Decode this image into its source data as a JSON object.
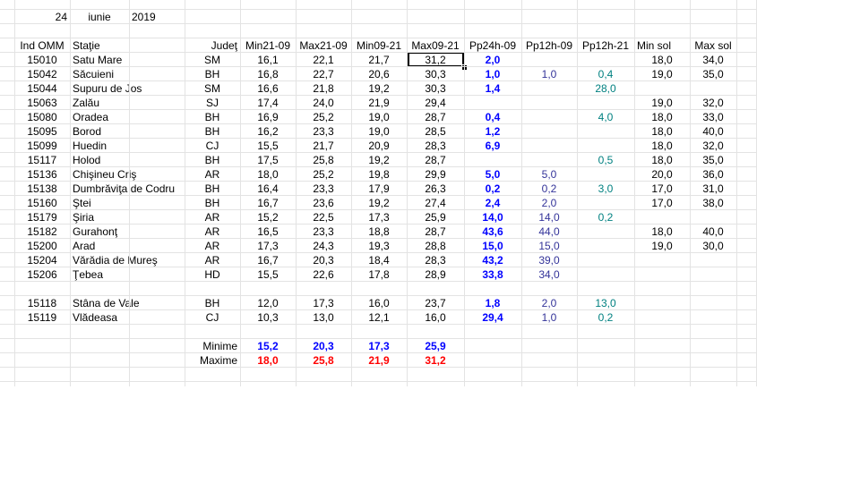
{
  "date": {
    "day": "24",
    "month": "iunie",
    "year": "2019"
  },
  "headers": [
    "Ind OMM",
    "Staţie",
    "Judeţ",
    "Min21-09",
    "Max21-09",
    "Min09-21",
    "Max09-21",
    "Pp24h-09",
    "Pp12h-09",
    "Pp12h-21",
    "Min sol",
    "Max sol"
  ],
  "rows": [
    {
      "ind": "15010",
      "statie": "Satu Mare",
      "judet": "SM",
      "min2109": "16,1",
      "max2109": "22,1",
      "min0921": "21,7",
      "max0921": "31,2",
      "pp24": "2,0",
      "pp12a": "",
      "pp12b": "",
      "minsol": "18,0",
      "maxsol": "34,0"
    },
    {
      "ind": "15042",
      "statie": "Săcuieni",
      "judet": "BH",
      "min2109": "16,8",
      "max2109": "22,7",
      "min0921": "20,6",
      "max0921": "30,3",
      "pp24": "1,0",
      "pp12a": "1,0",
      "pp12b": "0,4",
      "minsol": "19,0",
      "maxsol": "35,0"
    },
    {
      "ind": "15044",
      "statie": "Supuru de Jos",
      "judet": "SM",
      "min2109": "16,6",
      "max2109": "21,8",
      "min0921": "19,2",
      "max0921": "30,3",
      "pp24": "1,4",
      "pp12a": "",
      "pp12b": "28,0",
      "minsol": "",
      "maxsol": ""
    },
    {
      "ind": "15063",
      "statie": "Zalău",
      "judet": "SJ",
      "min2109": "17,4",
      "max2109": "24,0",
      "min0921": "21,9",
      "max0921": "29,4",
      "pp24": "",
      "pp12a": "",
      "pp12b": "",
      "minsol": "19,0",
      "maxsol": "32,0"
    },
    {
      "ind": "15080",
      "statie": "Oradea",
      "judet": "BH",
      "min2109": "16,9",
      "max2109": "25,2",
      "min0921": "19,0",
      "max0921": "28,7",
      "pp24": "0,4",
      "pp12a": "",
      "pp12b": "4,0",
      "minsol": "18,0",
      "maxsol": "33,0"
    },
    {
      "ind": "15095",
      "statie": "Borod",
      "judet": "BH",
      "min2109": "16,2",
      "max2109": "23,3",
      "min0921": "19,0",
      "max0921": "28,5",
      "pp24": "1,2",
      "pp12a": "",
      "pp12b": "",
      "minsol": "18,0",
      "maxsol": "40,0"
    },
    {
      "ind": "15099",
      "statie": "Huedin",
      "judet": "CJ",
      "min2109": "15,5",
      "max2109": "21,7",
      "min0921": "20,9",
      "max0921": "28,3",
      "pp24": "6,9",
      "pp12a": "",
      "pp12b": "",
      "minsol": "18,0",
      "maxsol": "32,0"
    },
    {
      "ind": "15117",
      "statie": "Holod",
      "judet": "BH",
      "min2109": "17,5",
      "max2109": "25,8",
      "min0921": "19,2",
      "max0921": "28,7",
      "pp24": "",
      "pp12a": "",
      "pp12b": "0,5",
      "minsol": "18,0",
      "maxsol": "35,0"
    },
    {
      "ind": "15136",
      "statie": "Chişineu    Criş",
      "judet": "AR",
      "min2109": "18,0",
      "max2109": "25,2",
      "min0921": "19,8",
      "max0921": "29,9",
      "pp24": "5,0",
      "pp12a": "5,0",
      "pp12b": "",
      "minsol": "20,0",
      "maxsol": "36,0"
    },
    {
      "ind": "15138",
      "statie": "Dumbrăviţa  de Codru",
      "judet": "BH",
      "min2109": "16,4",
      "max2109": "23,3",
      "min0921": "17,9",
      "max0921": "26,3",
      "pp24": "0,2",
      "pp12a": "0,2",
      "pp12b": "3,0",
      "minsol": "17,0",
      "maxsol": "31,0"
    },
    {
      "ind": "15160",
      "statie": "Ştei",
      "judet": "BH",
      "min2109": "16,7",
      "max2109": "23,6",
      "min0921": "19,2",
      "max0921": "27,4",
      "pp24": "2,4",
      "pp12a": "2,0",
      "pp12b": "",
      "minsol": "17,0",
      "maxsol": "38,0"
    },
    {
      "ind": "15179",
      "statie": "Şiria",
      "judet": "AR",
      "min2109": "15,2",
      "max2109": "22,5",
      "min0921": "17,3",
      "max0921": "25,9",
      "pp24": "14,0",
      "pp12a": "14,0",
      "pp12b": "0,2",
      "minsol": "",
      "maxsol": ""
    },
    {
      "ind": "15182",
      "statie": "Gurahonţ",
      "judet": "AR",
      "min2109": "16,5",
      "max2109": "23,3",
      "min0921": "18,8",
      "max0921": "28,7",
      "pp24": "43,6",
      "pp12a": "44,0",
      "pp12b": "",
      "minsol": "18,0",
      "maxsol": "40,0"
    },
    {
      "ind": "15200",
      "statie": "Arad",
      "judet": "AR",
      "min2109": "17,3",
      "max2109": "24,3",
      "min0921": "19,3",
      "max0921": "28,8",
      "pp24": "15,0",
      "pp12a": "15,0",
      "pp12b": "",
      "minsol": "19,0",
      "maxsol": "30,0"
    },
    {
      "ind": "15204",
      "statie": "Vărădia de Mureş",
      "judet": "AR",
      "min2109": "16,7",
      "max2109": "20,3",
      "min0921": "18,4",
      "max0921": "28,3",
      "pp24": "43,2",
      "pp12a": "39,0",
      "pp12b": "",
      "minsol": "",
      "maxsol": ""
    },
    {
      "ind": "15206",
      "statie": "Ţebea",
      "judet": "HD",
      "min2109": "15,5",
      "max2109": "22,6",
      "min0921": "17,8",
      "max0921": "28,9",
      "pp24": "33,8",
      "pp12a": "34,0",
      "pp12b": "",
      "minsol": "",
      "maxsol": ""
    },
    null,
    {
      "ind": "15118",
      "statie": "Stâna de Vale",
      "judet": "BH",
      "min2109": "12,0",
      "max2109": "17,3",
      "min0921": "16,0",
      "max0921": "23,7",
      "pp24": "1,8",
      "pp12a": "2,0",
      "pp12b": "13,0",
      "minsol": "",
      "maxsol": ""
    },
    {
      "ind": "15119",
      "statie": "Vlădeasa",
      "judet": "CJ",
      "min2109": "10,3",
      "max2109": "13,0",
      "min0921": "12,1",
      "max0921": "16,0",
      "pp24": "29,4",
      "pp12a": "1,0",
      "pp12b": "0,2",
      "minsol": "",
      "maxsol": ""
    }
  ],
  "summary": {
    "minime": {
      "label": "Minime",
      "min2109": "15,2",
      "max2109": "20,3",
      "min0921": "17,3",
      "max0921": "25,9"
    },
    "maxime": {
      "label": "Maxime",
      "min2109": "18,0",
      "max2109": "25,8",
      "min0921": "21,9",
      "max0921": "31,2"
    }
  },
  "colors": {
    "grid": "#e3e3e3",
    "blue": "#0000ff",
    "red": "#ff0000",
    "teal": "#008080",
    "navy": "#333399"
  }
}
